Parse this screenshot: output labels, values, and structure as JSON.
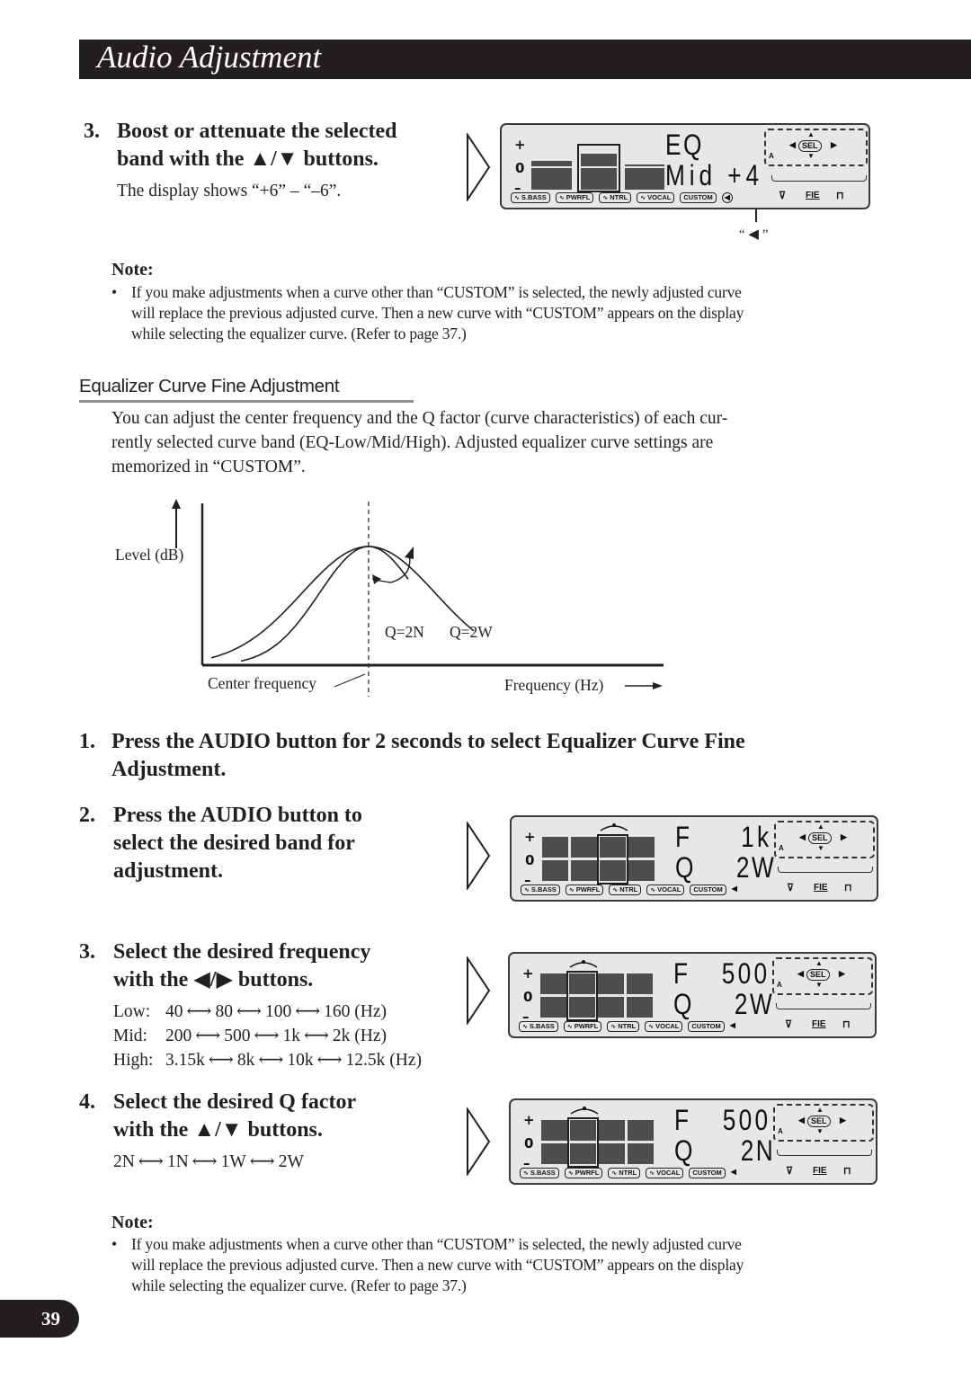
{
  "header": {
    "title": "Audio Adjustment"
  },
  "step_boost": {
    "number": "3.",
    "line1": "Boost or attenuate the selected",
    "line2": "band with the ▲/▼ buttons.",
    "desc": "The display shows “+6” – “–6”."
  },
  "lcd_eq": {
    "plus": "+",
    "zero": "0",
    "minus": "–",
    "top_text": "EQ",
    "bottom_text": "Mid +4",
    "sel_label": "SEL",
    "a_label": "A",
    "fie_label": "FIE",
    "presets": [
      "S.BASS",
      "PWRFL",
      "NTRL",
      "VOCAL",
      "CUSTOM"
    ],
    "callout_label": "“ ◀ ”",
    "icons": [
      "wave-icon",
      "speaker-icon",
      "filter-icon"
    ]
  },
  "note1": {
    "title": "Note:",
    "bullet": "•",
    "text_line1": "If you make adjustments when a curve other than “CUSTOM” is selected, the newly adjusted curve",
    "text_line2": "will replace the previous adjusted curve. Then a new curve with “CUSTOM” appears on the display",
    "text_line3": "while selecting the equalizer curve. (Refer to page 37.)"
  },
  "section": {
    "title": "Equalizer Curve Fine Adjustment",
    "para_line1": "You can adjust the center frequency and the Q factor (curve characteristics) of each cur-",
    "para_line2": "rently selected curve band (EQ-Low/Mid/High). Adjusted equalizer curve settings are",
    "para_line3": "memorized in “CUSTOM”."
  },
  "chart_data": {
    "type": "line",
    "title": "",
    "xlabel": "Frequency (Hz)",
    "ylabel": "Level (dB)",
    "annotations": [
      "Center frequency",
      "Q=2N",
      "Q=2W"
    ],
    "series": [
      {
        "name": "Q=2N",
        "shape": "narrow peak at center frequency"
      },
      {
        "name": "Q=2W",
        "shape": "wide peak at center frequency"
      }
    ],
    "center_marker": "dashed vertical line at center frequency",
    "grid": false,
    "legend": "none"
  },
  "steps": [
    {
      "number": "1.",
      "line1": "Press the AUDIO button for 2 seconds to select Equalizer Curve Fine",
      "line2": "Adjustment."
    },
    {
      "number": "2.",
      "line1": "Press the AUDIO button to",
      "line2": "select the desired band for",
      "line3": "adjustment."
    },
    {
      "number": "3.",
      "line1": "Select the desired frequency",
      "line2": "with the ◀/▶ buttons.",
      "freq_rows": [
        {
          "label": "Low:",
          "values": [
            "40",
            "80",
            "100",
            "160 (Hz)"
          ]
        },
        {
          "label": "Mid:",
          "values": [
            "200",
            "500",
            "1k",
            "2k (Hz)"
          ]
        },
        {
          "label": "High:",
          "values": [
            "3.15k",
            "8k",
            "10k",
            "12.5k (Hz)"
          ]
        }
      ]
    },
    {
      "number": "4.",
      "line1": "Select the desired Q factor",
      "line2": "with the ▲/▼ buttons.",
      "q_values": [
        "2N",
        "1N",
        "1W",
        "2W"
      ]
    }
  ],
  "arrow_glyph": "⟷",
  "lcd_fine": [
    {
      "f_label": "F",
      "f_value": "1k",
      "q_label": "Q",
      "q_value": "2W",
      "selected_band": 3
    },
    {
      "f_label": "F",
      "f_value": "500",
      "q_label": "Q",
      "q_value": "2W",
      "selected_band": 2
    },
    {
      "f_label": "F",
      "f_value": "500",
      "q_label": "Q",
      "q_value": "2N",
      "selected_band": 2
    }
  ],
  "note2": {
    "title": "Note:",
    "bullet": "•",
    "text_line1": "If you make adjustments when a curve other than “CUSTOM” is selected, the newly adjusted curve",
    "text_line2": "will replace the previous adjusted curve. Then a new curve with “CUSTOM” appears on the display",
    "text_line3": "while selecting the equalizer curve. (Refer to page 37.)"
  },
  "page_number": "39"
}
